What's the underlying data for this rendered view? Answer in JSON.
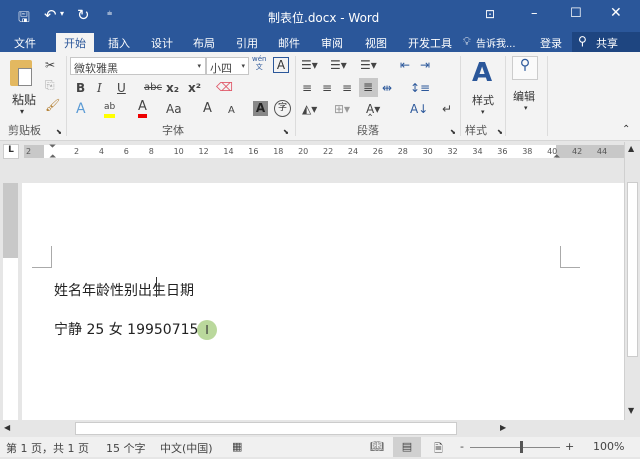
{
  "window": {
    "title": "制表位.docx - Word"
  },
  "qat": {
    "save": "save-icon",
    "undo": "undo-icon",
    "redo": "redo-icon",
    "customize": "customize-icon"
  },
  "tabs": [
    {
      "label": "文件"
    },
    {
      "label": "开始"
    },
    {
      "label": "插入"
    },
    {
      "label": "设计"
    },
    {
      "label": "布局"
    },
    {
      "label": "引用"
    },
    {
      "label": "邮件"
    },
    {
      "label": "审阅"
    },
    {
      "label": "视图"
    },
    {
      "label": "开发工具"
    }
  ],
  "tell_me": "告诉我...",
  "signin": "登录",
  "share": "共享",
  "ribbon": {
    "clipboard": {
      "paste": "粘贴",
      "group": "剪贴板"
    },
    "font": {
      "name": "微软雅黑",
      "size": "小四",
      "group": "字体",
      "wen": "wén",
      "wen_char": "文",
      "bold": "B",
      "italic": "I",
      "underline": "U",
      "strike": "abc",
      "sub": "x₂",
      "sup": "x²",
      "case": "Aa",
      "grow": "A",
      "shrink": "A",
      "shade": "A",
      "enclose": "字"
    },
    "paragraph": {
      "group": "段落"
    },
    "styles": {
      "label": "样式",
      "group": "样式"
    },
    "editing": {
      "label": "编辑"
    }
  },
  "ruler": {
    "ticks": [
      "2",
      "2",
      "4",
      "6",
      "8",
      "10",
      "12",
      "14",
      "16",
      "18",
      "20",
      "22",
      "24",
      "26",
      "28",
      "30",
      "32",
      "34",
      "36",
      "38",
      "40",
      "42",
      "44"
    ],
    "corner": "L"
  },
  "document": {
    "line1": "姓名年龄性别出生日期",
    "line2": "宁静 25 女 19950715"
  },
  "status": {
    "page": "第 1 页，共 1 页",
    "words": "15 个字",
    "lang": "中文(中国)",
    "zoom": "100%"
  },
  "colors": {
    "brand": "#2b579a"
  }
}
